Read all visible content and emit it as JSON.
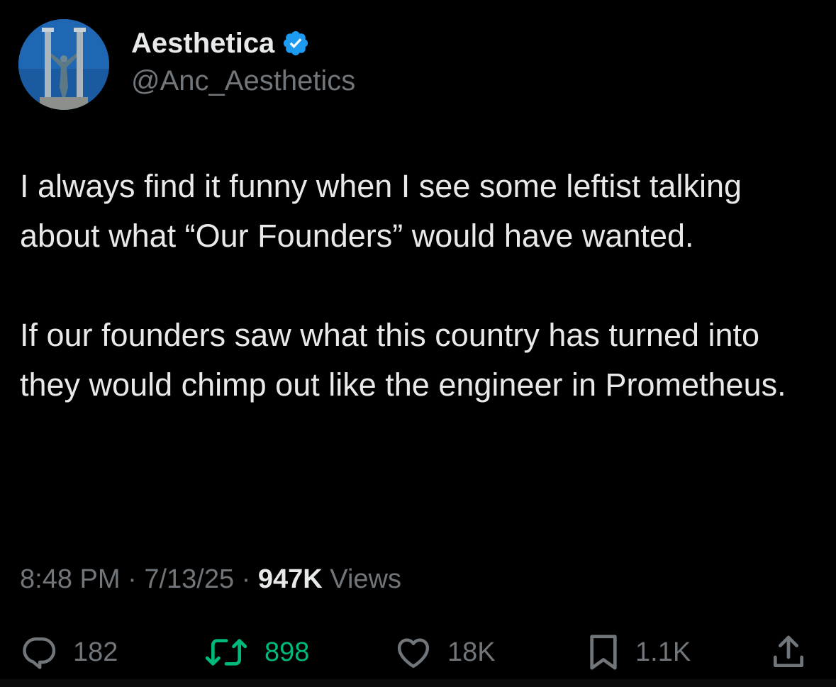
{
  "author": {
    "display_name": "Aesthetica",
    "handle": "@Anc_Aesthetics",
    "verified": true,
    "verified_color": "#1d9bf0"
  },
  "tweet": {
    "paragraphs": [
      "I always find it funny when I see some leftist talking about what “Our Founders” would have wanted.",
      "If our founders saw what this country has turned into they would chimp out like the engineer in Prometheus."
    ]
  },
  "meta": {
    "time": "8:48 PM",
    "separator": "·",
    "date": "7/13/25",
    "views_count": "947K",
    "views_label": "Views"
  },
  "actions": {
    "replies": "182",
    "reposts": "898",
    "likes": "18K",
    "bookmarks": "1.1K",
    "reply_icon": "reply-icon",
    "repost_icon": "repost-icon",
    "like_icon": "heart-icon",
    "bookmark_icon": "bookmark-icon",
    "share_icon": "share-icon",
    "repost_color": "#00ba7c"
  },
  "colors": {
    "background": "#000000",
    "text_primary": "#e7e9ea",
    "text_secondary": "#71767b"
  }
}
